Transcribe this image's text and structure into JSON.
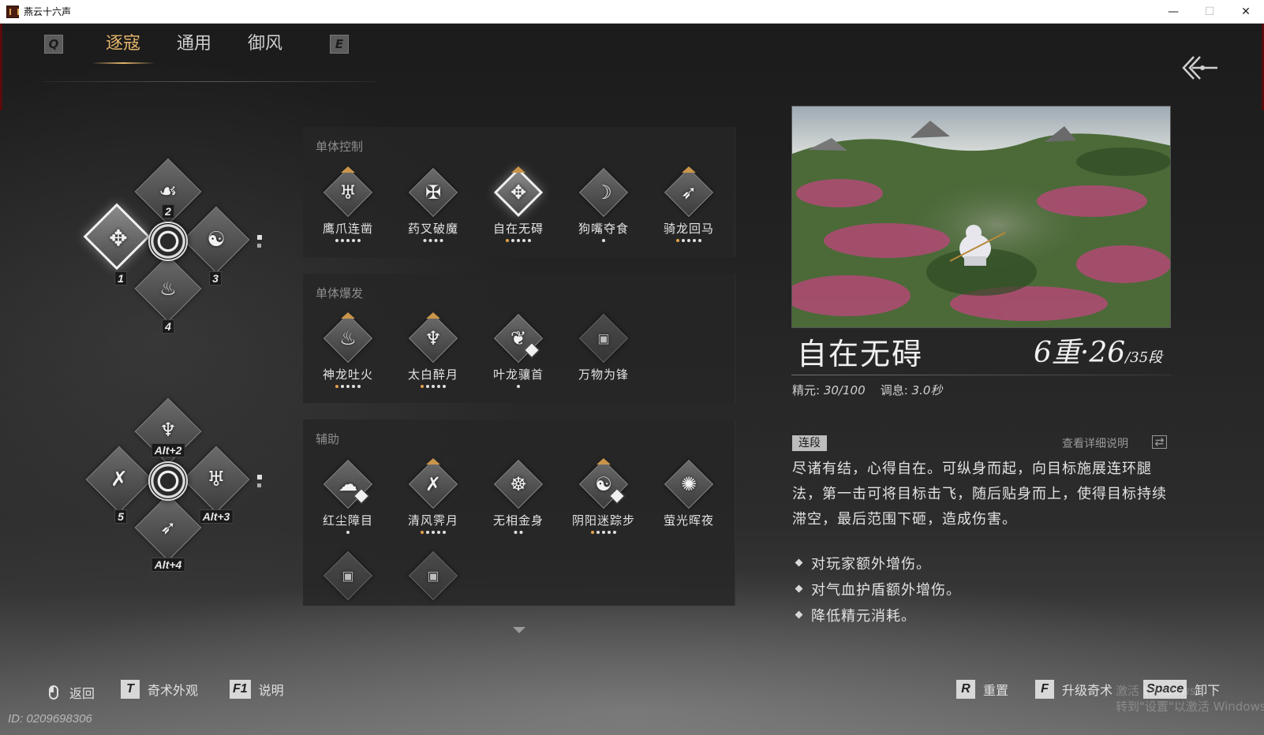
{
  "window": {
    "title": "燕云十六声",
    "controls": {
      "minimize": "—",
      "maximize": "☐",
      "close": "✕"
    }
  },
  "tabs": {
    "left_key": "Q",
    "right_key": "E",
    "items": [
      {
        "label": "逐寇",
        "active": true
      },
      {
        "label": "通用",
        "active": false
      },
      {
        "label": "御风",
        "active": false
      }
    ]
  },
  "loadout": {
    "slots": [
      {
        "label": "1",
        "icon": "crane-kick-icon"
      },
      {
        "label": "2",
        "icon": "claw-icon"
      },
      {
        "label": "3",
        "icon": "taiji-icon"
      },
      {
        "label": "4",
        "icon": "dragon-fire-icon"
      },
      {
        "label": "5",
        "icon": "cross-blades-icon"
      },
      {
        "label": "Alt+2",
        "icon": "drunk-moon-icon"
      },
      {
        "label": "Alt+3",
        "icon": "eagle-claw-icon"
      },
      {
        "label": "Alt+4",
        "icon": "spear-icon"
      }
    ]
  },
  "categories": [
    {
      "title": "单体控制",
      "skills": [
        {
          "name": "鹰爪连凿",
          "icon": "eagle-claw-icon",
          "upgradable": true,
          "level": 5,
          "gold_dots": 0
        },
        {
          "name": "药叉破魔",
          "icon": "yaksha-icon",
          "upgradable": false,
          "level": 4,
          "gold_dots": 0
        },
        {
          "name": "自在无碍",
          "icon": "crane-kick-icon",
          "upgradable": true,
          "level": 5,
          "gold_dots": 1,
          "selected": true
        },
        {
          "name": "狗嘴夺食",
          "icon": "dog-bite-icon",
          "upgradable": false,
          "level": 1,
          "gold_dots": 0
        },
        {
          "name": "骑龙回马",
          "icon": "spear-icon",
          "upgradable": true,
          "level": 5,
          "gold_dots": 1
        }
      ]
    },
    {
      "title": "单体爆发",
      "skills": [
        {
          "name": "神龙吐火",
          "icon": "dragon-fire-icon",
          "upgradable": true,
          "level": 5,
          "gold_dots": 1
        },
        {
          "name": "太白醉月",
          "icon": "drunk-moon-icon",
          "upgradable": true,
          "level": 5,
          "gold_dots": 1
        },
        {
          "name": "叶龙骧首",
          "icon": "dragon-head-icon",
          "upgradable": false,
          "level": 1,
          "gold_dots": 0,
          "swap_badge": true
        },
        {
          "name": "万物为锋",
          "icon": "lock-icon",
          "upgradable": false,
          "level": 0,
          "gold_dots": 0,
          "locked": true
        }
      ]
    },
    {
      "title": "辅助",
      "skills": [
        {
          "name": "红尘障目",
          "icon": "dust-icon",
          "upgradable": false,
          "level": 1,
          "gold_dots": 0,
          "swap_badge": true
        },
        {
          "name": "清风霁月",
          "icon": "cross-blades-icon",
          "upgradable": true,
          "level": 5,
          "gold_dots": 1
        },
        {
          "name": "无相金身",
          "icon": "meditate-icon",
          "upgradable": false,
          "level": 2,
          "gold_dots": 0
        },
        {
          "name": "阴阳迷踪步",
          "icon": "taiji-icon",
          "upgradable": true,
          "level": 5,
          "gold_dots": 1,
          "swap_badge": true
        },
        {
          "name": "萤光晖夜",
          "icon": "firefly-icon",
          "upgradable": false,
          "level": 0,
          "gold_dots": 0
        },
        {
          "name": "",
          "icon": "lock-icon",
          "locked": true
        },
        {
          "name": "",
          "icon": "lock-icon",
          "locked": true
        }
      ]
    }
  ],
  "detail": {
    "name": "自在无碍",
    "level_main": "6重",
    "level_sep": "·",
    "level_sub": "26",
    "level_total": "/35段",
    "energy_label": "精元:",
    "energy_value": "30/100",
    "cooldown_label": "调息:",
    "cooldown_value": "3.0秒",
    "tag": "连段",
    "detail_link": "查看详细说明",
    "description": "尽诸有结，心得自在。可纵身而起，向目标施展连环腿法，第一击可将目标击飞，随后贴身而上，使得目标持续滞空，最后范围下砸，造成伤害。",
    "bullets": [
      "对玩家额外增伤。",
      "对气血护盾额外增伤。",
      "降低精元消耗。"
    ]
  },
  "footer": {
    "left": [
      {
        "key": "mouse",
        "label": "返回"
      },
      {
        "key": "T",
        "label": "奇术外观"
      },
      {
        "key": "F1",
        "label": "说明"
      }
    ],
    "right": [
      {
        "key": "R",
        "label": "重置"
      },
      {
        "key": "F",
        "label": "升级奇术"
      },
      {
        "key": "Space",
        "label": "卸下"
      }
    ],
    "player_id": "ID: 0209698306",
    "watermark_line1": "激活 Windows",
    "watermark_line2": "转到\"设置\"以激活 Windows。"
  },
  "colors": {
    "accent_gold": "#e3b46b",
    "upgrade_gold": "#c9954a",
    "panel_bg": "#262626"
  }
}
